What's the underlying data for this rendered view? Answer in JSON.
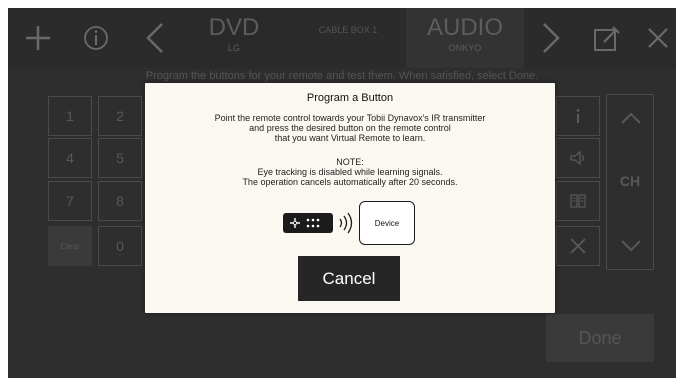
{
  "topbar": {
    "tabs": [
      {
        "label": "DVD",
        "sub": "LG"
      },
      {
        "label": "CABLE BOX 1",
        "sub": ""
      },
      {
        "label": "AUDIO",
        "sub": "ONKYO"
      }
    ],
    "icons": [
      "plus-icon",
      "info-icon",
      "chevron-left-icon",
      "chevron-right-icon",
      "edit-icon",
      "close-icon"
    ]
  },
  "instructions": "Program the buttons for your remote and test them. When satisfied, select Done.",
  "keypad": {
    "keys": [
      "1",
      "2",
      "4",
      "5",
      "7",
      "8",
      "Clear",
      "0"
    ]
  },
  "side_controls": {
    "ch_label": "CH",
    "icons": [
      "info-icon",
      "mute-icon",
      "guide-icon",
      "cross-icon"
    ]
  },
  "done_label": "Done",
  "modal": {
    "title": "Program a Button",
    "line1": "Point the remote control towards your Tobii Dynavox's IR transmitter",
    "line2": "and press the desired button on the remote control",
    "line3": "that you want Virtual Remote to learn.",
    "note_heading": "NOTE:",
    "note1": "Eye tracking is disabled while learning signals.",
    "note2": "The operation cancels automatically after 20 seconds.",
    "device_label": "Device",
    "cancel_label": "Cancel"
  }
}
